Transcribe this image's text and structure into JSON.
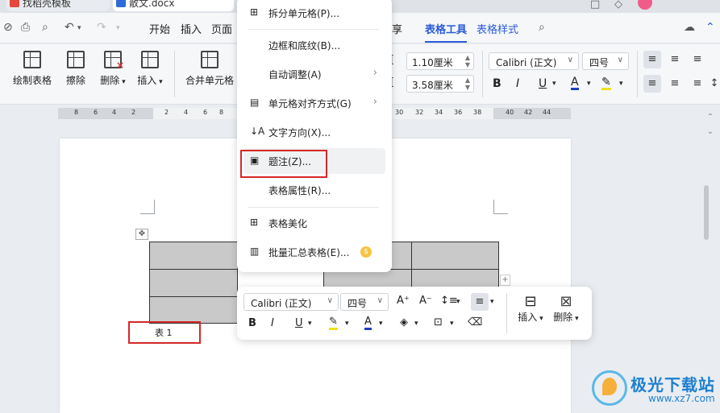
{
  "tabs": [
    {
      "label": "找稻壳模板"
    },
    {
      "label": "散文.docx"
    }
  ],
  "menu": {
    "items": [
      "开始",
      "插入",
      "页面"
    ],
    "share": "享",
    "table_tools": "表格工具",
    "table_style": "表格样式"
  },
  "ribbon": {
    "draw_table": "绘制表格",
    "erase": "擦除",
    "delete": "删除",
    "insert": "插入",
    "merge_cells": "合并单元格",
    "height_value": "1.10厘米",
    "width_value": "3.58厘米",
    "font_name": "Calibri (正文)",
    "font_size": "四号"
  },
  "ruler": {
    "left_numbers": [
      "8",
      "6",
      "4",
      "2"
    ],
    "right_numbers": [
      "2",
      "4",
      "6",
      "8"
    ],
    "far_numbers": [
      "30",
      "32",
      "34",
      "36",
      "38",
      "40",
      "42",
      "44"
    ]
  },
  "context_menu": {
    "items": [
      {
        "label": "拆分单元格(P)...",
        "icon": "split-cells-icon"
      },
      {
        "label": "边框和底纹(B)..."
      },
      {
        "label": "自动调整(A)",
        "submenu": true
      },
      {
        "label": "单元格对齐方式(G)",
        "submenu": true,
        "icon": "cell-align-icon"
      },
      {
        "label": "文字方向(X)...",
        "icon": "text-direction-icon"
      },
      {
        "label": "题注(Z)...",
        "icon": "caption-icon"
      },
      {
        "label": "表格属性(R)..."
      },
      {
        "label": "表格美化",
        "icon": "table-beautify-icon"
      },
      {
        "label": "批量汇总表格(E)...",
        "icon": "batch-summary-icon"
      }
    ],
    "coin_symbol": "$"
  },
  "document": {
    "caption_text": "表 1"
  },
  "mini_toolbar": {
    "font_name": "Calibri (正文)",
    "font_size": "四号",
    "insert": "插入",
    "delete": "删除"
  },
  "watermark": {
    "title": "极光下载站",
    "url": "www.xz7.com"
  },
  "colors": {
    "accent": "#2a5bd7",
    "highlight_red": "#d62828",
    "table_fill": "#c9c9c9"
  }
}
